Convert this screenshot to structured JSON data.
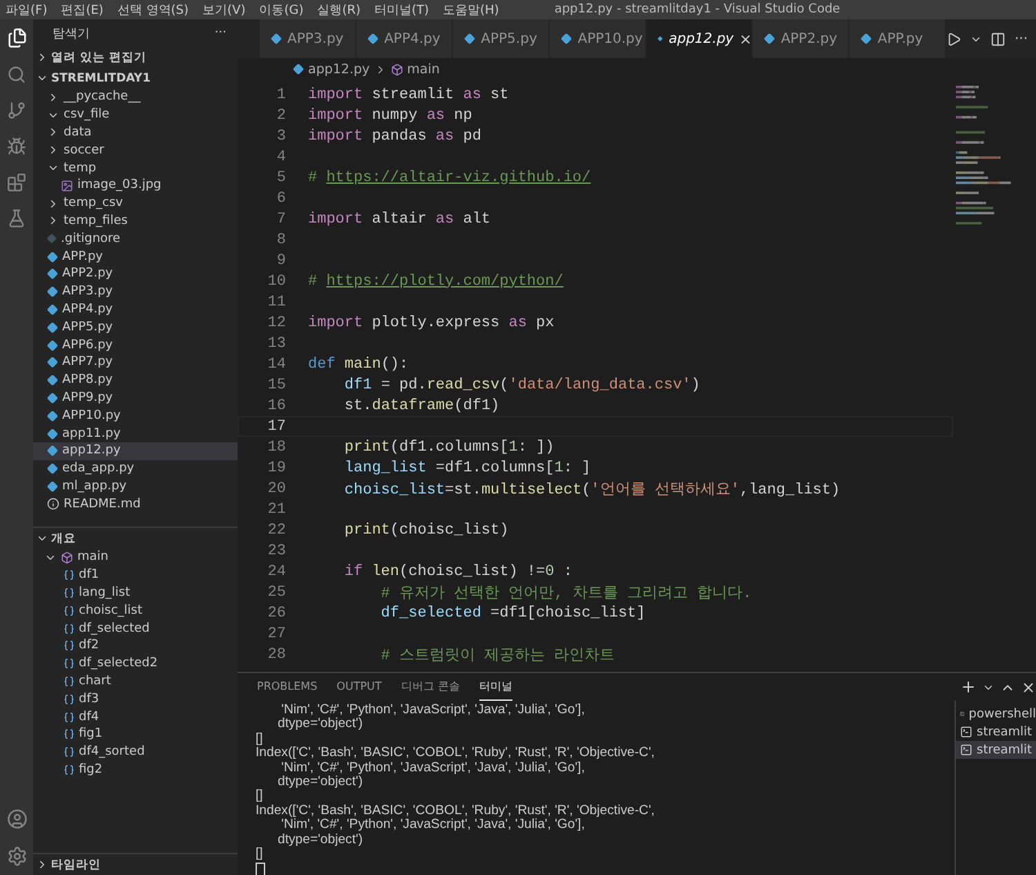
{
  "menu_bar": {
    "items": [
      "파일(F)",
      "편집(E)",
      "선택 영역(S)",
      "보기(V)",
      "이동(G)",
      "실행(R)",
      "터미널(T)",
      "도움말(H)"
    ],
    "title": "app12.py - streamlitday1 - Visual Studio Code"
  },
  "sidebar": {
    "title": "탐색기",
    "more": "···",
    "open_editors": {
      "label": "열려 있는 편집기",
      "expanded": false
    },
    "project": {
      "label": "STREMLITDAY1",
      "expanded": true,
      "items": [
        {
          "name": "__pycache__",
          "kind": "folder",
          "expanded": false,
          "selected": false
        },
        {
          "name": "csv_file",
          "kind": "folder",
          "expanded": true,
          "selected": false
        },
        {
          "name": "data",
          "kind": "folder",
          "expanded": false,
          "selected": false
        },
        {
          "name": "soccer",
          "kind": "folder",
          "expanded": false,
          "selected": false
        },
        {
          "name": "temp",
          "kind": "folder",
          "expanded": true,
          "selected": false,
          "children": [
            {
              "name": "image_03.jpg",
              "kind": "image",
              "selected": false
            }
          ]
        },
        {
          "name": "temp_csv",
          "kind": "folder",
          "expanded": false,
          "selected": false
        },
        {
          "name": "temp_files",
          "kind": "folder",
          "expanded": false,
          "selected": false
        },
        {
          "name": ".gitignore",
          "kind": "git",
          "selected": false
        },
        {
          "name": "APP.py",
          "kind": "python",
          "selected": false
        },
        {
          "name": "APP2.py",
          "kind": "python",
          "selected": false
        },
        {
          "name": "APP3.py",
          "kind": "python",
          "selected": false
        },
        {
          "name": "APP4.py",
          "kind": "python",
          "selected": false
        },
        {
          "name": "APP5.py",
          "kind": "python",
          "selected": false
        },
        {
          "name": "APP6.py",
          "kind": "python",
          "selected": false
        },
        {
          "name": "APP7.py",
          "kind": "python",
          "selected": false
        },
        {
          "name": "APP8.py",
          "kind": "python",
          "selected": false
        },
        {
          "name": "APP9.py",
          "kind": "python",
          "selected": false
        },
        {
          "name": "APP10.py",
          "kind": "python",
          "selected": false
        },
        {
          "name": "app11.py",
          "kind": "python",
          "selected": false
        },
        {
          "name": "app12.py",
          "kind": "python",
          "selected": true
        },
        {
          "name": "eda_app.py",
          "kind": "python",
          "selected": false
        },
        {
          "name": "ml_app.py",
          "kind": "python",
          "selected": false
        },
        {
          "name": "README.md",
          "kind": "info",
          "selected": false
        }
      ]
    },
    "outline": {
      "label": "개요",
      "expanded": true,
      "items": [
        {
          "name": "main",
          "kind": "function",
          "expanded": true,
          "children": [
            {
              "name": "df1",
              "kind": "variable"
            },
            {
              "name": "lang_list",
              "kind": "variable"
            },
            {
              "name": "choisc_list",
              "kind": "variable"
            },
            {
              "name": "df_selected",
              "kind": "variable"
            },
            {
              "name": "df2",
              "kind": "variable"
            },
            {
              "name": "df_selected2",
              "kind": "variable"
            },
            {
              "name": "chart",
              "kind": "variable"
            },
            {
              "name": "df3",
              "kind": "variable"
            },
            {
              "name": "df4",
              "kind": "variable"
            },
            {
              "name": "fig1",
              "kind": "variable"
            },
            {
              "name": "df4_sorted",
              "kind": "variable"
            },
            {
              "name": "fig2",
              "kind": "variable"
            }
          ]
        }
      ]
    },
    "timeline": {
      "label": "타임라인",
      "expanded": false
    }
  },
  "tabs": [
    {
      "label": "APP3.py",
      "selected": false
    },
    {
      "label": "APP4.py",
      "selected": false
    },
    {
      "label": "APP5.py",
      "selected": false
    },
    {
      "label": "APP10.py",
      "selected": false
    },
    {
      "label": "app12.py",
      "selected": true,
      "close": "×"
    },
    {
      "label": "APP2.py",
      "selected": false
    },
    {
      "label": "APP.py",
      "selected": false
    }
  ],
  "editor_actions": {
    "more": "···"
  },
  "breadcrumb": [
    "app12.py",
    "main"
  ],
  "code_lines": [
    {
      "number": "1",
      "current": false,
      "tokens": [
        {
          "kind": "keyword",
          "text": "import"
        },
        {
          "kind": "plain",
          "text": " streamlit "
        },
        {
          "kind": "keyword",
          "text": "as"
        },
        {
          "kind": "plain",
          "text": " st"
        }
      ]
    },
    {
      "number": "2",
      "current": false,
      "tokens": [
        {
          "kind": "keyword",
          "text": "import"
        },
        {
          "kind": "plain",
          "text": " numpy "
        },
        {
          "kind": "keyword",
          "text": "as"
        },
        {
          "kind": "plain",
          "text": " np"
        }
      ]
    },
    {
      "number": "3",
      "current": false,
      "tokens": [
        {
          "kind": "keyword",
          "text": "import"
        },
        {
          "kind": "plain",
          "text": " pandas "
        },
        {
          "kind": "keyword",
          "text": "as"
        },
        {
          "kind": "plain",
          "text": " pd"
        }
      ]
    },
    {
      "number": "4",
      "current": false
    },
    {
      "number": "5",
      "current": false,
      "tokens": [
        {
          "kind": "comment",
          "text": "# "
        },
        {
          "kind": "link",
          "text": "https://altair-viz.github.io/"
        }
      ]
    },
    {
      "number": "6",
      "current": false
    },
    {
      "number": "7",
      "current": false,
      "tokens": [
        {
          "kind": "keyword",
          "text": "import"
        },
        {
          "kind": "plain",
          "text": " altair "
        },
        {
          "kind": "keyword",
          "text": "as"
        },
        {
          "kind": "plain",
          "text": " alt"
        }
      ]
    },
    {
      "number": "8",
      "current": false
    },
    {
      "number": "9",
      "current": false
    },
    {
      "number": "10",
      "current": false,
      "tokens": [
        {
          "kind": "comment",
          "text": "# "
        },
        {
          "kind": "link",
          "text": "https://plotly.com/python/"
        }
      ]
    },
    {
      "number": "11",
      "current": false
    },
    {
      "number": "12",
      "current": false,
      "tokens": [
        {
          "kind": "keyword",
          "text": "import"
        },
        {
          "kind": "plain",
          "text": " plotly.express "
        },
        {
          "kind": "keyword",
          "text": "as"
        },
        {
          "kind": "plain",
          "text": " px"
        }
      ]
    },
    {
      "number": "13",
      "current": false
    },
    {
      "number": "14",
      "current": false,
      "tokens": [
        {
          "kind": "def",
          "text": "def"
        },
        {
          "kind": "function",
          "text": " main"
        },
        {
          "kind": "plain",
          "text": "():"
        }
      ]
    },
    {
      "number": "15",
      "current": false,
      "tokens": [
        {
          "kind": "variable",
          "text": "    df1"
        },
        {
          "kind": "plain",
          "text": " = pd."
        },
        {
          "kind": "function",
          "text": "read_csv"
        },
        {
          "kind": "plain",
          "text": "("
        },
        {
          "kind": "string",
          "text": "'data/lang_data.csv'"
        },
        {
          "kind": "plain",
          "text": ")"
        }
      ]
    },
    {
      "number": "16",
      "current": false,
      "tokens": [
        {
          "kind": "plain",
          "text": "    st."
        },
        {
          "kind": "function",
          "text": "dataframe"
        },
        {
          "kind": "plain",
          "text": "(df1)"
        }
      ]
    },
    {
      "number": "17",
      "current": true
    },
    {
      "number": "18",
      "current": false,
      "tokens": [
        {
          "kind": "function",
          "text": "    print"
        },
        {
          "kind": "plain",
          "text": "(df1.columns["
        },
        {
          "kind": "number",
          "text": "1"
        },
        {
          "kind": "plain",
          "text": ": ])"
        }
      ]
    },
    {
      "number": "19",
      "current": false,
      "tokens": [
        {
          "kind": "variable",
          "text": "    lang_list"
        },
        {
          "kind": "plain",
          "text": " =df1.columns["
        },
        {
          "kind": "number",
          "text": "1"
        },
        {
          "kind": "plain",
          "text": ": ]"
        }
      ]
    },
    {
      "number": "20",
      "current": false,
      "tokens": [
        {
          "kind": "variable",
          "text": "    choisc_list"
        },
        {
          "kind": "plain",
          "text": "=st."
        },
        {
          "kind": "function",
          "text": "multiselect"
        },
        {
          "kind": "plain",
          "text": "("
        },
        {
          "kind": "string",
          "text": "'언어를 선택하세요'"
        },
        {
          "kind": "plain",
          "text": ",lang_list)"
        }
      ]
    },
    {
      "number": "21",
      "current": false
    },
    {
      "number": "22",
      "current": false,
      "tokens": [
        {
          "kind": "function",
          "text": "    print"
        },
        {
          "kind": "plain",
          "text": "(choisc_list)"
        }
      ]
    },
    {
      "number": "23",
      "current": false
    },
    {
      "number": "24",
      "current": false,
      "tokens": [
        {
          "kind": "keyword",
          "text": "    if"
        },
        {
          "kind": "function",
          "text": " len"
        },
        {
          "kind": "plain",
          "text": "(choisc_list) !="
        },
        {
          "kind": "number",
          "text": "0"
        },
        {
          "kind": "plain",
          "text": " :"
        }
      ]
    },
    {
      "number": "25",
      "current": false,
      "tokens": [
        {
          "kind": "comment",
          "text": "        # 유저가 선택한 언어만, 차트를 그리려고 합니다."
        }
      ]
    },
    {
      "number": "26",
      "current": false,
      "tokens": [
        {
          "kind": "variable",
          "text": "        df_selected"
        },
        {
          "kind": "plain",
          "text": " =df1[choisc_list]"
        }
      ]
    },
    {
      "number": "27",
      "current": false
    },
    {
      "number": "28",
      "current": false,
      "tokens": [
        {
          "kind": "comment",
          "text": "        # 스트럼릿이 제공하는 라인차트"
        }
      ]
    }
  ],
  "panel": {
    "tabs": [
      {
        "label": "PROBLEMS",
        "selected": false
      },
      {
        "label": "OUTPUT",
        "selected": false
      },
      {
        "label": "디버그 콘솔",
        "selected": false
      },
      {
        "label": "터미널",
        "selected": true
      }
    ],
    "terminal_lines": [
      "       'Nim', 'C#', 'Python', 'JavaScript', 'Java', 'Julia', 'Go'],",
      "      dtype='object')",
      "[]",
      "Index(['C', 'Bash', 'BASIC', 'COBOL', 'Ruby', 'Rust', 'R', 'Objective-C',",
      "       'Nim', 'C#', 'Python', 'JavaScript', 'Java', 'Julia', 'Go'],",
      "      dtype='object')",
      "[]",
      "Index(['C', 'Bash', 'BASIC', 'COBOL', 'Ruby', 'Rust', 'R', 'Objective-C',",
      "       'Nim', 'C#', 'Python', 'JavaScript', 'Java', 'Julia', 'Go'],",
      "      dtype='object')",
      "[]"
    ],
    "terminals": [
      {
        "name": "powershell",
        "kind": "powershell",
        "selected": false
      },
      {
        "name": "streamlit",
        "kind": "task",
        "selected": false
      },
      {
        "name": "streamlit",
        "kind": "task",
        "selected": true
      }
    ]
  }
}
